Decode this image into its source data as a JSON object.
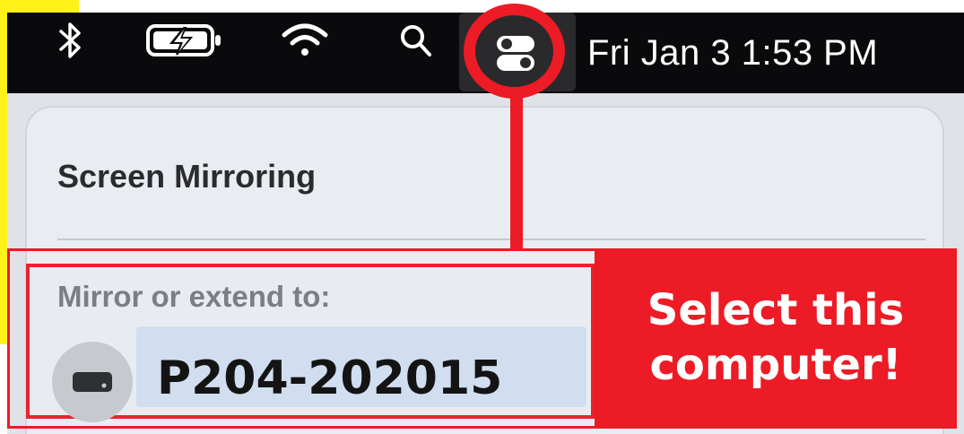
{
  "menubar": {
    "icons": [
      "bluetooth-icon",
      "battery-charging-icon",
      "wifi-icon",
      "search-icon",
      "control-center-icon"
    ],
    "clock": "Fri Jan 3  1:53 PM"
  },
  "panel": {
    "title": "Screen Mirroring",
    "section_label": "Mirror or extend to:",
    "device": {
      "name": "P204-202015",
      "icon": "display-device-icon"
    }
  },
  "annotation": {
    "callout_text": "Select this\ncomputer!",
    "accent": "#ec1b25",
    "highlight": "#fff21a"
  }
}
